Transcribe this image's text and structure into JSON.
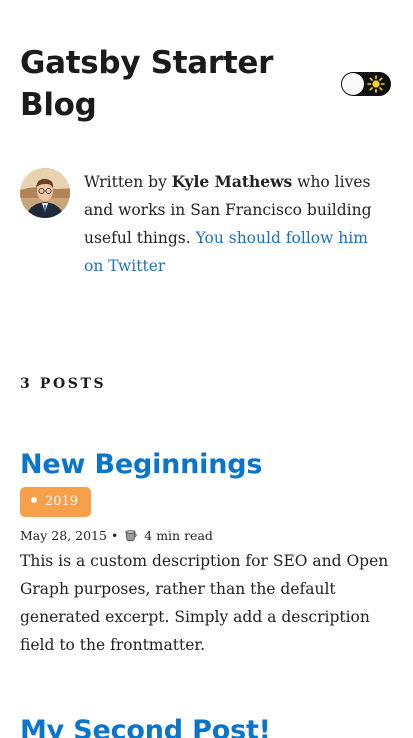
{
  "site": {
    "title": "Gatsby Starter Blog"
  },
  "theme_toggle": {
    "icon": "sun-icon",
    "state": "light"
  },
  "bio": {
    "avatar": "avatar-photo",
    "prefix": "Written by ",
    "author": "Kyle Mathews",
    "middle": " who lives and works in San Francisco building useful things. ",
    "link_text": "You should follow him on Twitter"
  },
  "posts_count": "3 POSTS",
  "posts": [
    {
      "title": "New Beginnings",
      "tag": "2019",
      "date": "May 28, 2015",
      "separator": "•",
      "reading_icon": "coffee-cup-icon",
      "read_time": "4 min read",
      "excerpt": "This is a custom description for SEO and Open Graph purposes, rather than the default generated excerpt. Simply add a description field to the frontmatter."
    },
    {
      "title": "My Second Post!"
    }
  ],
  "colors": {
    "link": "#1d6fbf",
    "post_title": "#0b75c9",
    "tag_bg": "#f6a04a",
    "toggle_bg": "#101010"
  }
}
